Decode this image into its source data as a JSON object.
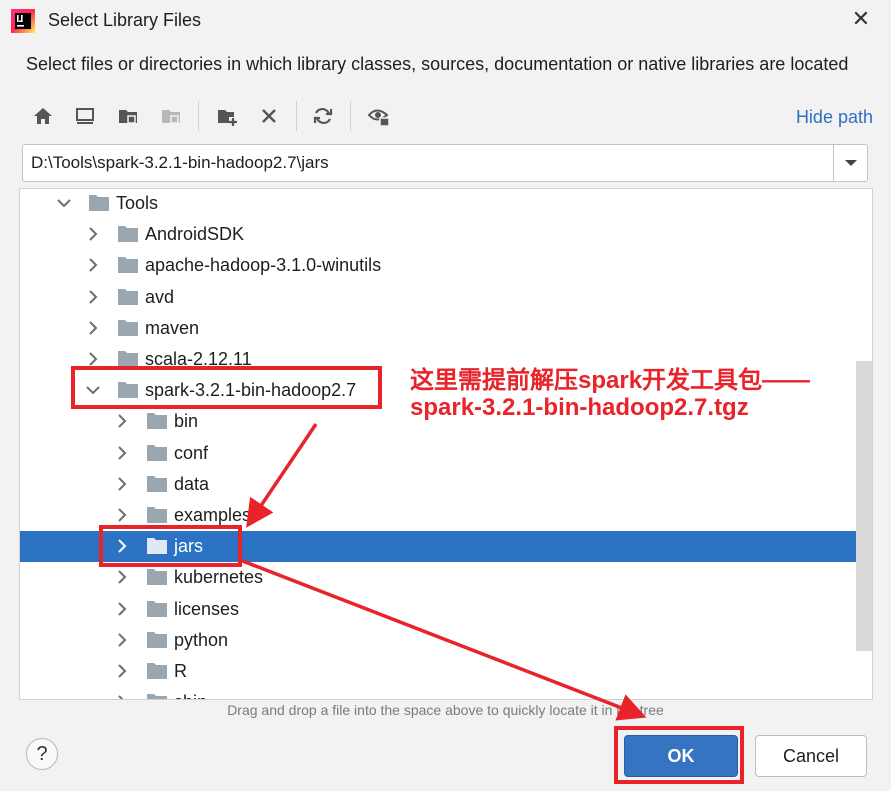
{
  "dialog": {
    "title": "Select Library Files",
    "description": "Select files or directories in which library classes, sources, documentation or native libraries are located"
  },
  "toolbar": {
    "icons": [
      "home-icon",
      "desktop-icon",
      "project-folder-icon",
      "module-folder-icon",
      "new-folder-icon",
      "delete-icon",
      "refresh-icon",
      "show-hidden-icon"
    ],
    "hide_path_label": "Hide path"
  },
  "path": {
    "value": "D:\\Tools\\spark-3.2.1-bin-hadoop2.7\\jars"
  },
  "tree": {
    "items": [
      {
        "label": "Tools",
        "level": 0,
        "expanded": true
      },
      {
        "label": "AndroidSDK",
        "level": 1,
        "expanded": false
      },
      {
        "label": "apache-hadoop-3.1.0-winutils",
        "level": 1,
        "expanded": false
      },
      {
        "label": "avd",
        "level": 1,
        "expanded": false
      },
      {
        "label": "maven",
        "level": 1,
        "expanded": false
      },
      {
        "label": "scala-2.12.11",
        "level": 1,
        "expanded": false
      },
      {
        "label": "spark-3.2.1-bin-hadoop2.7",
        "level": 1,
        "expanded": true
      },
      {
        "label": "bin",
        "level": 2,
        "expanded": false
      },
      {
        "label": "conf",
        "level": 2,
        "expanded": false
      },
      {
        "label": "data",
        "level": 2,
        "expanded": false
      },
      {
        "label": "examples",
        "level": 2,
        "expanded": false
      },
      {
        "label": "jars",
        "level": 2,
        "expanded": false,
        "selected": true
      },
      {
        "label": "kubernetes",
        "level": 2,
        "expanded": false
      },
      {
        "label": "licenses",
        "level": 2,
        "expanded": false
      },
      {
        "label": "python",
        "level": 2,
        "expanded": false
      },
      {
        "label": "R",
        "level": 2,
        "expanded": false
      },
      {
        "label": "sbin",
        "level": 2,
        "expanded": false
      }
    ]
  },
  "hint": "Drag and drop a file into the space above to quickly locate it in the tree",
  "buttons": {
    "help": "?",
    "ok": "OK",
    "cancel": "Cancel"
  },
  "annotation": {
    "line1": "这里需提前解压spark开发工具包——",
    "line2": "spark-3.2.1-bin-hadoop2.7.tgz",
    "color": "#e8232a"
  },
  "colors": {
    "selection": "#2c73c4",
    "link": "#2f6fc4",
    "folder": "#9aa7b0"
  }
}
